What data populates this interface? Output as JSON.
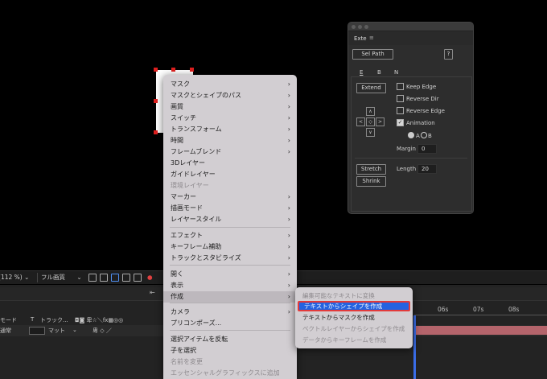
{
  "viewer_toolbar": {
    "zoom": "112 %)",
    "resolution": "フル画質"
  },
  "timeline": {
    "col_mode": "モード",
    "col_t": "T",
    "col_track": "トラック...",
    "row_mode": "通常",
    "row_matte": "マット",
    "ticks": [
      "06s",
      "07s",
      "08s"
    ]
  },
  "exte_panel": {
    "title": "Exte",
    "sel_path": "Sel Path",
    "help": "?",
    "tabs": [
      "E",
      "B",
      "N"
    ],
    "extend": "Extend",
    "keep_edge": "Keep Edge",
    "reverse_dir": "Reverse Dir",
    "reverse_edge": "Reverse Edge",
    "animation": "Animation",
    "radio_a": "A",
    "radio_b": "B",
    "margin_label": "Margin",
    "margin_value": "0",
    "stretch": "Stretch",
    "shrink": "Shrink",
    "length_label": "Length",
    "length_value": "20"
  },
  "context_menu": {
    "items": [
      {
        "label": "マスク",
        "sub": true
      },
      {
        "label": "マスクとシェイプのパス",
        "sub": true
      },
      {
        "label": "画質",
        "sub": true
      },
      {
        "label": "スイッチ",
        "sub": true
      },
      {
        "label": "トランスフォーム",
        "sub": true
      },
      {
        "label": "時間",
        "sub": true
      },
      {
        "label": "フレームブレンド",
        "sub": true
      },
      {
        "label": "3Dレイヤー",
        "sub": false
      },
      {
        "label": "ガイドレイヤー",
        "sub": false
      },
      {
        "label": "環境レイヤー",
        "sub": false,
        "disabled": true
      },
      {
        "label": "マーカー",
        "sub": true
      },
      {
        "label": "描画モード",
        "sub": true
      },
      {
        "label": "レイヤースタイル",
        "sub": true
      },
      {
        "label": "エフェクト",
        "sub": true
      },
      {
        "label": "キーフレーム補助",
        "sub": true
      },
      {
        "label": "トラックとスタビライズ",
        "sub": true
      },
      {
        "label": "開く",
        "sub": true
      },
      {
        "label": "表示",
        "sub": true
      },
      {
        "label": "作成",
        "sub": true
      },
      {
        "label": "カメラ",
        "sub": true
      },
      {
        "label": "プリコンポーズ...",
        "sub": false
      },
      {
        "label": "選択アイテムを反転",
        "sub": false
      },
      {
        "label": "子を選択",
        "sub": false
      },
      {
        "label": "名前を変更",
        "sub": false,
        "disabled": true
      },
      {
        "label": "エッセンシャルグラフィックスに追加",
        "sub": false,
        "disabled": true
      }
    ]
  },
  "submenu": {
    "items": [
      {
        "label": "編集可能なテキストに変換",
        "disabled": true
      },
      {
        "label": "テキストからシェイプを作成",
        "highlighted": true
      },
      {
        "label": "テキストからマスクを作成"
      },
      {
        "label": "ベクトルレイヤーからシェイプを作成",
        "disabled": true
      },
      {
        "label": "データからキーフレームを作成",
        "disabled": true
      }
    ]
  }
}
